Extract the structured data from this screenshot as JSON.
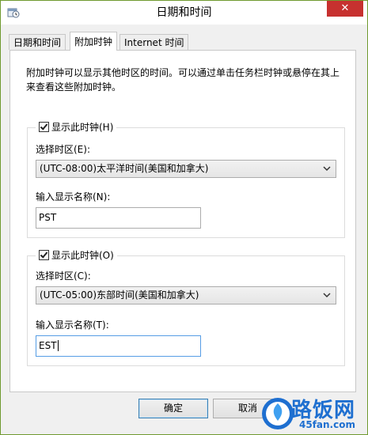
{
  "window": {
    "title": "日期和时间",
    "close_glyph": "✕"
  },
  "tabs": [
    {
      "label": "日期和时间",
      "active": false
    },
    {
      "label": "附加时钟",
      "active": true
    },
    {
      "label": "Internet 时间",
      "active": false
    }
  ],
  "description": "附加时钟可以显示其他时区的时间。可以通过单击任务栏时钟或悬停在其上来查看这些附加时钟。",
  "clock1": {
    "checkbox_label": "显示此时钟(H)",
    "checked": true,
    "zone_label": "选择时区(E):",
    "zone_value": "(UTC-08:00)太平洋时间(美国和加拿大)",
    "name_label": "输入显示名称(N):",
    "name_value": "PST"
  },
  "clock2": {
    "checkbox_label": "显示此时钟(O)",
    "checked": true,
    "zone_label": "选择时区(C):",
    "zone_value": "(UTC-05:00)东部时间(美国和加拿大)",
    "name_label": "输入显示名称(T):",
    "name_value": "EST"
  },
  "buttons": {
    "ok": "确定",
    "cancel": "取消"
  },
  "watermark": {
    "text": "路饭网",
    "sub": "45fan.com"
  },
  "colors": {
    "close_button": "#c7312f",
    "focus_border": "#569de5",
    "watermark": "#1e6fd0"
  }
}
